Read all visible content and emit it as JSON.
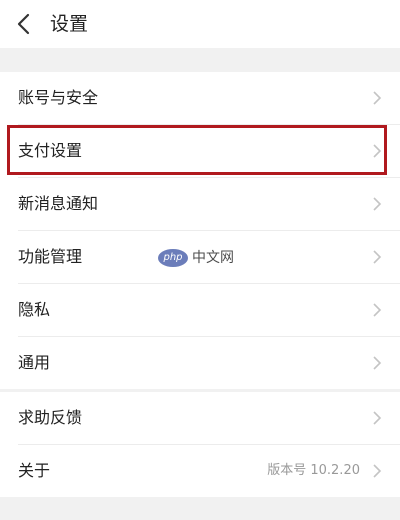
{
  "header": {
    "title": "设置",
    "back_icon": "chevron-left-icon"
  },
  "groups": [
    {
      "items": [
        {
          "label": "账号与安全"
        },
        {
          "label": "支付设置"
        },
        {
          "label": "新消息通知"
        },
        {
          "label": "功能管理"
        },
        {
          "label": "隐私"
        },
        {
          "label": "通用"
        }
      ]
    },
    {
      "items": [
        {
          "label": "求助反馈"
        },
        {
          "label": "关于",
          "value": "版本号 10.2.20"
        }
      ]
    }
  ],
  "watermark": {
    "logo_text": "php",
    "text": "中文网"
  },
  "colors": {
    "background": "#f1f1f1",
    "highlight_border": "#b0191e",
    "chevron": "#c4c4c4",
    "secondary_text": "#999999"
  }
}
